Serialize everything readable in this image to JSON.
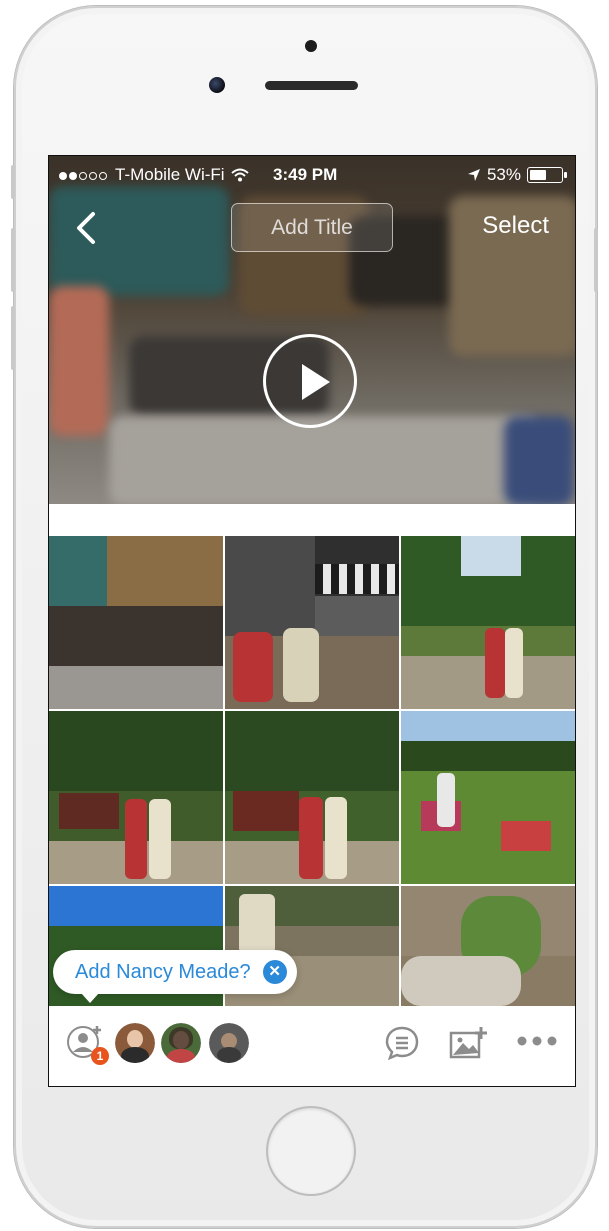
{
  "status_bar": {
    "carrier": "T-Mobile Wi-Fi",
    "time": "3:49 PM",
    "battery": "53%",
    "icons": [
      "signal-dots-icon",
      "wifi-icon",
      "location-arrow-icon",
      "battery-icon"
    ]
  },
  "header": {
    "back_icon": "chevron-left-icon",
    "title_placeholder": "Add Title",
    "select_label": "Select"
  },
  "hero": {
    "play_icon": "play-icon"
  },
  "suggestion": {
    "text": "Add Nancy Meade?",
    "close_icon": "close-icon"
  },
  "toolbar": {
    "add_person_icon": "add-person-icon",
    "badge_count": "1",
    "people": [
      "avatar-1",
      "avatar-2",
      "avatar-3"
    ],
    "actions": [
      "comment-icon",
      "add-photo-icon",
      "more-icon"
    ]
  },
  "colors": {
    "accent": "#2a89d8",
    "badge": "#e8541e"
  }
}
